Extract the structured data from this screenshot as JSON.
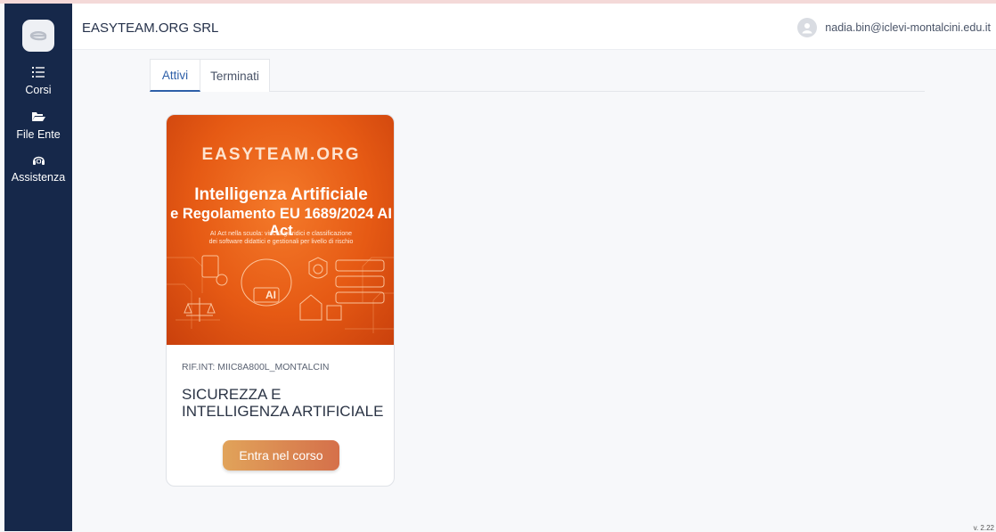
{
  "header": {
    "org_name": "EASYTEAM.ORG SRL",
    "user_email": "nadia.bin@iclevi-montalcini.edu.it"
  },
  "sidebar": {
    "items": [
      {
        "label": "Corsi",
        "icon": "list-icon"
      },
      {
        "label": "File Ente",
        "icon": "folder-open-icon"
      },
      {
        "label": "Assistenza",
        "icon": "headset-icon"
      }
    ]
  },
  "tabs": [
    {
      "label": "Attivi",
      "active": true
    },
    {
      "label": "Terminati",
      "active": false
    }
  ],
  "course": {
    "image": {
      "brand": "EASYTEAM.ORG",
      "title_line1": "Intelligenza Artificiale",
      "title_line2": "e Regolamento EU 1689/2024 AI Act",
      "subtitle_line1": "AI Act nella scuola: vincoli giuridici e classificazione",
      "subtitle_line2": "dei software didattici e gestionali per livello di rischio"
    },
    "ref": "RIF.INT: MIIC8A800L_MONTALCIN",
    "title": "SICUREZZA E INTELLIGENZA ARTIFICIALE",
    "button_label": "Entra nel corso"
  },
  "version": "v. 2.22",
  "colors": {
    "sidebar_bg": "#16284a",
    "accent": "#2d5fa8",
    "button_start": "#e1a35a",
    "button_end": "#d5704a",
    "banner_orange": "#e65a14"
  }
}
